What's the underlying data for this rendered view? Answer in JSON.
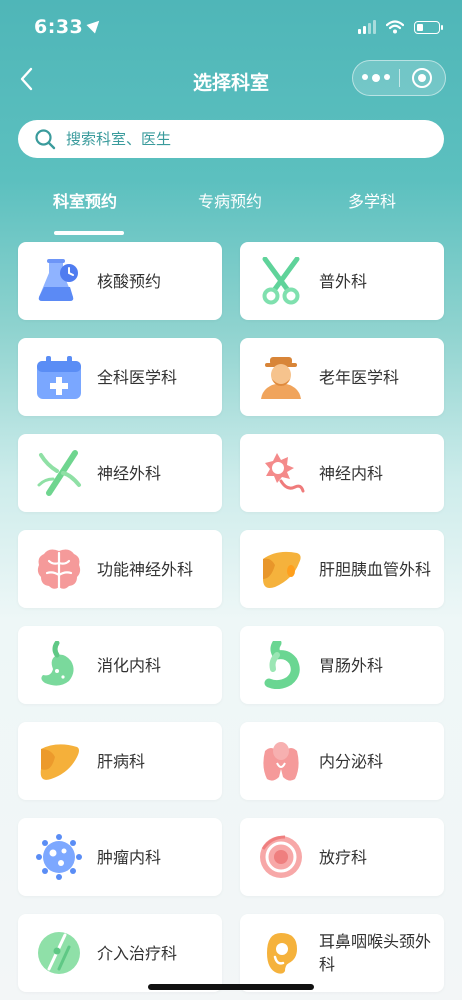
{
  "status_bar": {
    "time": "6:33"
  },
  "nav": {
    "title": "选择科室",
    "back_icon": "chevron-left-icon"
  },
  "search": {
    "placeholder": "搜索科室、医生"
  },
  "tabs": [
    {
      "label": "科室预约",
      "active": true
    },
    {
      "label": "专病预约",
      "active": false
    },
    {
      "label": "多学科",
      "active": false
    }
  ],
  "departments": [
    {
      "label": "核酸预约",
      "icon": "lab-flask-icon"
    },
    {
      "label": "普外科",
      "icon": "scissors-icon"
    },
    {
      "label": "全科医学科",
      "icon": "medical-kit-icon"
    },
    {
      "label": "老年医学科",
      "icon": "elderly-person-icon"
    },
    {
      "label": "神经外科",
      "icon": "nerve-icon"
    },
    {
      "label": "神经内科",
      "icon": "neuron-icon"
    },
    {
      "label": "功能神经外科",
      "icon": "brain-icon"
    },
    {
      "label": "肝胆胰血管外科",
      "icon": "liver-gallbladder-icon"
    },
    {
      "label": "消化内科",
      "icon": "stomach-icon"
    },
    {
      "label": "胃肠外科",
      "icon": "stomach-intestine-icon"
    },
    {
      "label": "肝病科",
      "icon": "liver-icon"
    },
    {
      "label": "内分泌科",
      "icon": "thyroid-icon"
    },
    {
      "label": "肿瘤内科",
      "icon": "tumor-cell-icon"
    },
    {
      "label": "放疗科",
      "icon": "radiation-target-icon"
    },
    {
      "label": "介入治疗科",
      "icon": "interventional-icon"
    },
    {
      "label": "耳鼻咽喉头颈外科",
      "icon": "ear-icon"
    }
  ],
  "colors": {
    "primary": "#4fb6b8",
    "text": "#333333"
  }
}
